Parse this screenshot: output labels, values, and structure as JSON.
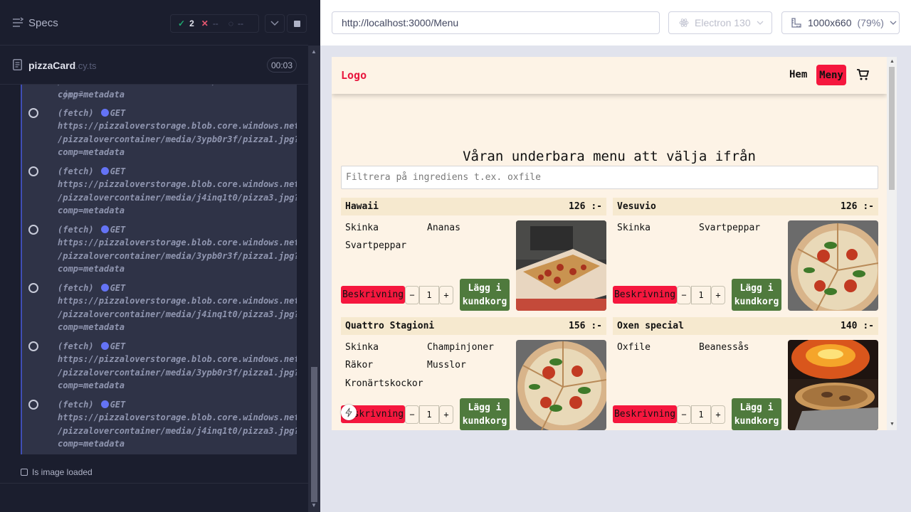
{
  "reporter": {
    "header": {
      "title": "Specs",
      "passed": "2",
      "failed": "--",
      "pending": "--"
    },
    "spec": {
      "name": "pizzaCard",
      "ext": ".cy.ts",
      "duration": "00:03"
    },
    "log": {
      "cutoff_line": "comp=metadata",
      "commands": [
        {
          "kind": "(fetch)",
          "method": "GET",
          "lines": [
            "https://pizzaloverstorage.blob.core.windows.net",
            "/pizzalovercontainer/media/3ypb0r3f/pizza1.jpg?",
            "comp=metadata"
          ]
        },
        {
          "kind": "(fetch)",
          "method": "GET",
          "lines": [
            "https://pizzaloverstorage.blob.core.windows.net",
            "/pizzalovercontainer/media/j4inq1t0/pizza3.jpg?",
            "comp=metadata"
          ]
        },
        {
          "kind": "(fetch)",
          "method": "GET",
          "lines": [
            "https://pizzaloverstorage.blob.core.windows.net",
            "/pizzalovercontainer/media/3ypb0r3f/pizza1.jpg?",
            "comp=metadata"
          ]
        },
        {
          "kind": "(fetch)",
          "method": "GET",
          "lines": [
            "https://pizzaloverstorage.blob.core.windows.net",
            "/pizzalovercontainer/media/j4inq1t0/pizza3.jpg?",
            "comp=metadata"
          ]
        },
        {
          "kind": "(fetch)",
          "method": "GET",
          "lines": [
            "https://pizzaloverstorage.blob.core.windows.net",
            "/pizzalovercontainer/media/3ypb0r3f/pizza1.jpg?",
            "comp=metadata"
          ]
        },
        {
          "kind": "(fetch)",
          "method": "GET",
          "lines": [
            "https://pizzaloverstorage.blob.core.windows.net",
            "/pizzalovercontainer/media/j4inq1t0/pizza3.jpg?",
            "comp=metadata"
          ]
        }
      ]
    },
    "test_title": "Is image loaded"
  },
  "aut": {
    "url": "http://localhost:3000/Menu",
    "browser": "Electron 130",
    "viewport": "1000x660",
    "zoom": "(79%)"
  },
  "app": {
    "logo": "Logo",
    "nav": {
      "home": "Hem",
      "menu": "Meny"
    },
    "headline": "Våran underbara menu att välja ifrån",
    "filter_placeholder": "Filtrera på ingrediens t.ex. oxfile",
    "desc_label": "Beskrivning",
    "add_label_1": "Lägg i",
    "add_label_2": "kundkorg",
    "pizzas": [
      {
        "name": "Hawaii",
        "price": "126 :-",
        "ingredients": [
          "Skinka",
          "Ananas",
          "Svartpeppar"
        ],
        "qty": "1"
      },
      {
        "name": "Vesuvio",
        "price": "126 :-",
        "ingredients": [
          "Skinka",
          "Svartpeppar"
        ],
        "qty": "1"
      },
      {
        "name": "Quattro Stagioni",
        "price": "156 :-",
        "ingredients": [
          "Skinka",
          "Champinjoner",
          "Räkor",
          "Musslor",
          "Kronärtskockor"
        ],
        "qty": "1"
      },
      {
        "name": "Oxen special",
        "price": "140 :-",
        "ingredients": [
          "Oxfile",
          "Beanessås"
        ],
        "qty": "1"
      }
    ]
  }
}
